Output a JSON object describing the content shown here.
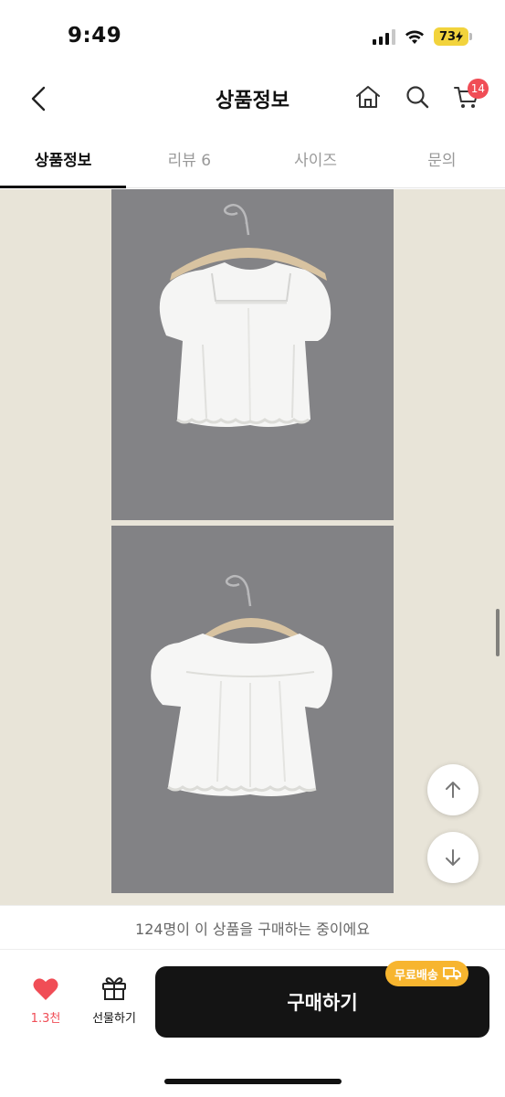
{
  "status_bar": {
    "time": "9:49",
    "battery": "73",
    "icons": [
      "signal-icon",
      "wifi-icon",
      "battery-icon"
    ]
  },
  "header": {
    "title": "상품정보",
    "cart_count": "14",
    "icons": [
      "back-icon",
      "home-icon",
      "search-icon",
      "cart-icon"
    ]
  },
  "tabs": [
    {
      "label": "상품정보",
      "active": true
    },
    {
      "label": "리뷰 6",
      "active": false
    },
    {
      "label": "사이즈",
      "active": false
    },
    {
      "label": "문의",
      "active": false
    }
  ],
  "content": {
    "images": [
      "white-blouse-front-photo",
      "white-blouse-back-photo"
    ]
  },
  "floating": {
    "up_icon": "arrow-up-icon",
    "down_icon": "arrow-down-icon"
  },
  "notice": {
    "text": "124명이 이 상품을 구매하는 중이에요"
  },
  "bottom_bar": {
    "like_count": "1.3천",
    "gift_label": "선물하기",
    "buy_label": "구매하기",
    "shipping_badge": "무료배송"
  },
  "colors": {
    "accent_red": "#f04d56",
    "buy_button": "#141414",
    "shipping_badge": "#f7b52f",
    "battery": "#f2d33c"
  }
}
